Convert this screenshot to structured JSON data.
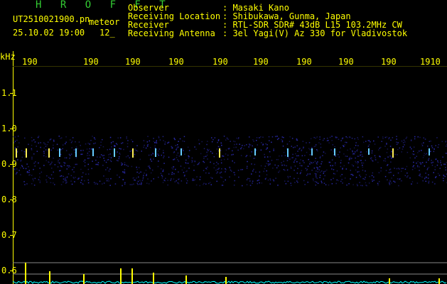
{
  "header": {
    "station": "H R O F F T",
    "filename": "UT2510021900.pn",
    "meteor_label": "meteor",
    "datetime": "25.10.02 19:00",
    "count": "12_",
    "fields": [
      {
        "label": "Observer",
        "value": ": Masaki Kano"
      },
      {
        "label": "Receiving Location",
        "value": ": Shibukawa, Gunma, Japan"
      },
      {
        "label": "Receiver",
        "value": ": RTL-SDR SDR# 43dB L15 103.2MHz CW"
      },
      {
        "label": "Receiving Antenna",
        "value": ": 3el Yagi(V) Az 330 for Vladivostok"
      }
    ]
  },
  "axis": {
    "y_unit": "kHz",
    "y_ticks": [
      "1.1",
      "1.0",
      "0.9",
      "0.8",
      "0.7",
      "0.6"
    ],
    "x_ticks": [
      "190",
      "190",
      "190",
      "190",
      "190",
      "190",
      "190",
      "190",
      "190",
      "1910"
    ]
  },
  "colors": {
    "text": "#ffff00",
    "station": "#33cc33",
    "background": "#000000",
    "noise": "#000066",
    "trace": "#00ffff"
  }
}
